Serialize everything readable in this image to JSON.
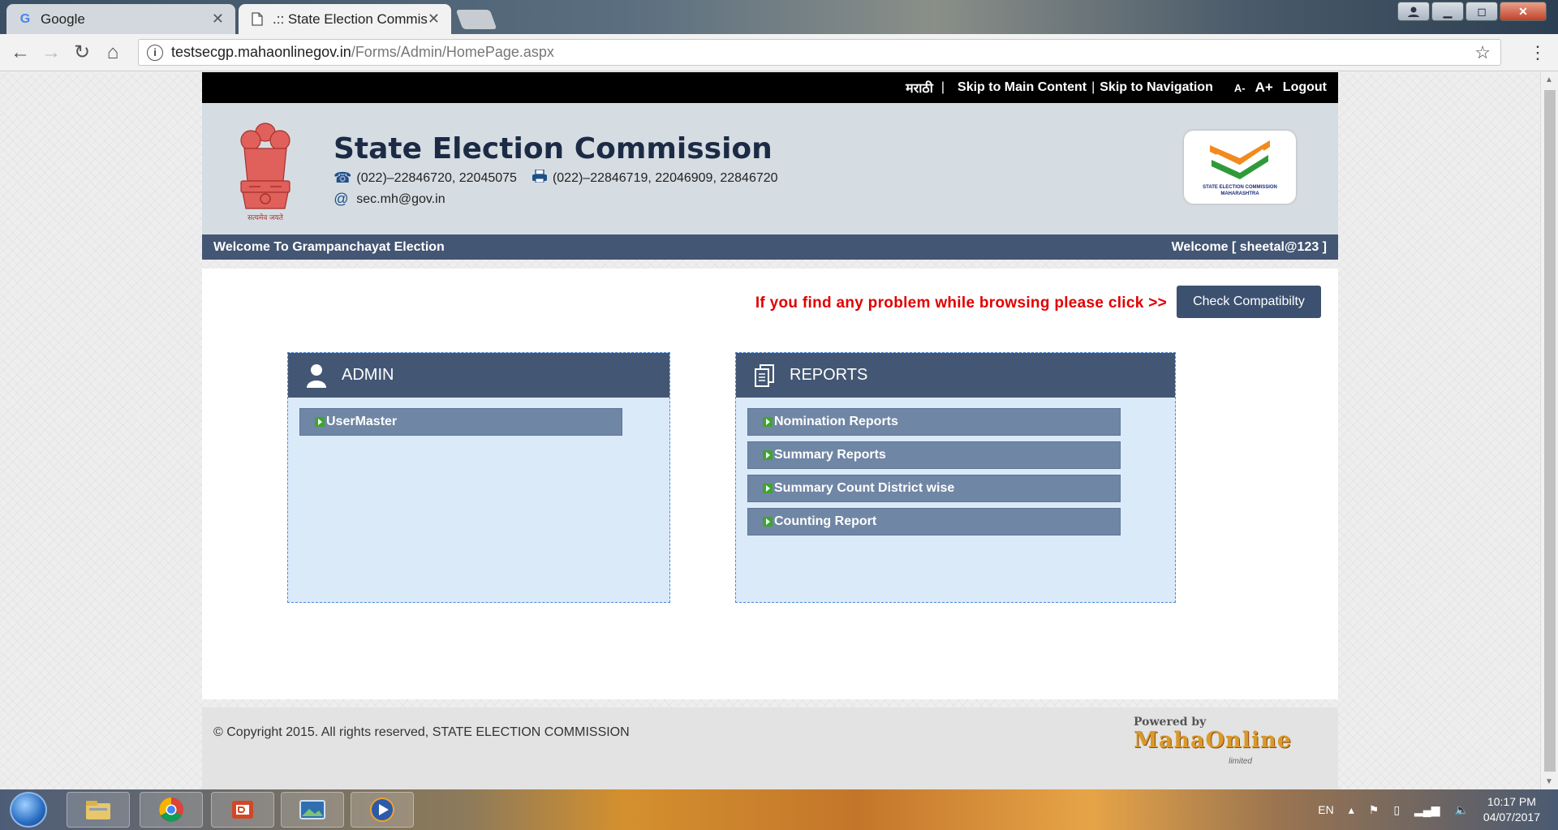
{
  "browser": {
    "tabs": [
      {
        "title": "Google",
        "favicon": "google-icon",
        "active": false
      },
      {
        "title": ".:: State Election Commiss",
        "favicon": "page-icon",
        "active": true
      }
    ],
    "url": {
      "host": "testsecgp.mahaonlinegov.in",
      "path": "/Forms/Admin/HomePage.aspx"
    }
  },
  "topbar": {
    "marathi": "मराठी",
    "separator": "|",
    "skip_main": "Skip to Main Content",
    "skip_nav": "Skip to Navigation",
    "font_decrease": "A-",
    "font_increase": "A+",
    "logout": "Logout"
  },
  "header": {
    "title": "State Election Commission",
    "phone": "(022)–22846720, 22045075",
    "fax": "(022)–22846719, 22046909, 22846720",
    "email": "sec.mh@gov.in",
    "logo_text_line1": "STATE ELECTION COMMISSION",
    "logo_text_line2": "MAHARASHTRA",
    "emblem_caption": "सत्यमेव जयते"
  },
  "welcome_bar": {
    "left": "Welcome To Grampanchayat Election",
    "right": "Welcome [ sheetal@123 ]"
  },
  "notice": {
    "text": "If you find any problem while browsing please click >>",
    "button": "Check Compatibilty"
  },
  "admin_panel": {
    "title": "ADMIN",
    "items": [
      {
        "label": "UserMaster"
      }
    ]
  },
  "reports_panel": {
    "title": "REPORTS",
    "items": [
      {
        "label": "Nomination Reports"
      },
      {
        "label": "Summary Reports"
      },
      {
        "label": "Summary Count District wise"
      },
      {
        "label": "Counting Report"
      }
    ]
  },
  "footer": {
    "copyright": "© Copyright 2015. All rights reserved, STATE ELECTION COMMISSION",
    "powered_by": "Powered by",
    "brand": "MahaOnline",
    "brand_suffix": "limited"
  },
  "taskbar": {
    "language": "EN",
    "time": "10:17 PM",
    "date": "04/07/2017"
  }
}
